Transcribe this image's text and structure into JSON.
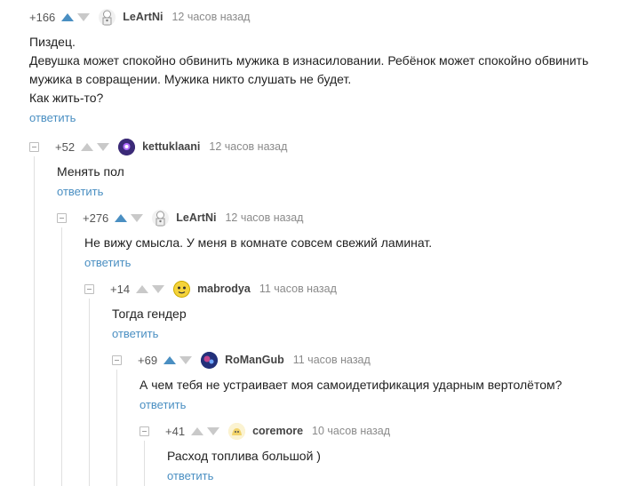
{
  "comments": [
    {
      "rating": "+166",
      "user": "LeArtNi",
      "time": "12 часов назад",
      "text": "Пиздец.\nДевушка может спокойно обвинить мужика в изнасиловании. Ребёнок может спокойно обвинить мужика в совращении. Мужика никто слушать не будет.\nКак жить-то?",
      "reply": "ответить",
      "vote_up_active": true,
      "avatar_icon": "cook-avatar-icon"
    },
    {
      "rating": "+52",
      "user": "kettuklaani",
      "time": "12 часов назад",
      "text": "Менять пол",
      "reply": "ответить",
      "vote_up_active": false,
      "avatar_icon": "space-avatar-icon"
    },
    {
      "rating": "+276",
      "user": "LeArtNi",
      "time": "12 часов назад",
      "text": "Не вижу смысла. У меня в комнате совсем свежий ламинат.",
      "reply": "ответить",
      "vote_up_active": true,
      "avatar_icon": "cook-avatar-icon"
    },
    {
      "rating": "+14",
      "user": "mabrodya",
      "time": "11 часов назад",
      "text": "Тогда гендер",
      "reply": "ответить",
      "vote_up_active": false,
      "avatar_icon": "smiley-avatar-icon"
    },
    {
      "rating": "+69",
      "user": "RoManGub",
      "time": "11 часов назад",
      "text": "А чем тебя не устраивает моя самоидетификация ударным вертолётом?",
      "reply": "ответить",
      "vote_up_active": true,
      "avatar_icon": "galaxy-avatar-icon"
    },
    {
      "rating": "+41",
      "user": "coremore",
      "time": "10 часов назад",
      "text": "Расход топлива большой )",
      "reply": "ответить",
      "vote_up_active": false,
      "avatar_icon": "blob-avatar-icon"
    }
  ],
  "colors": {
    "accent": "#4a8fc2",
    "vote_inactive": "#c9c9c9",
    "branch_line": "#e0e0e0"
  }
}
